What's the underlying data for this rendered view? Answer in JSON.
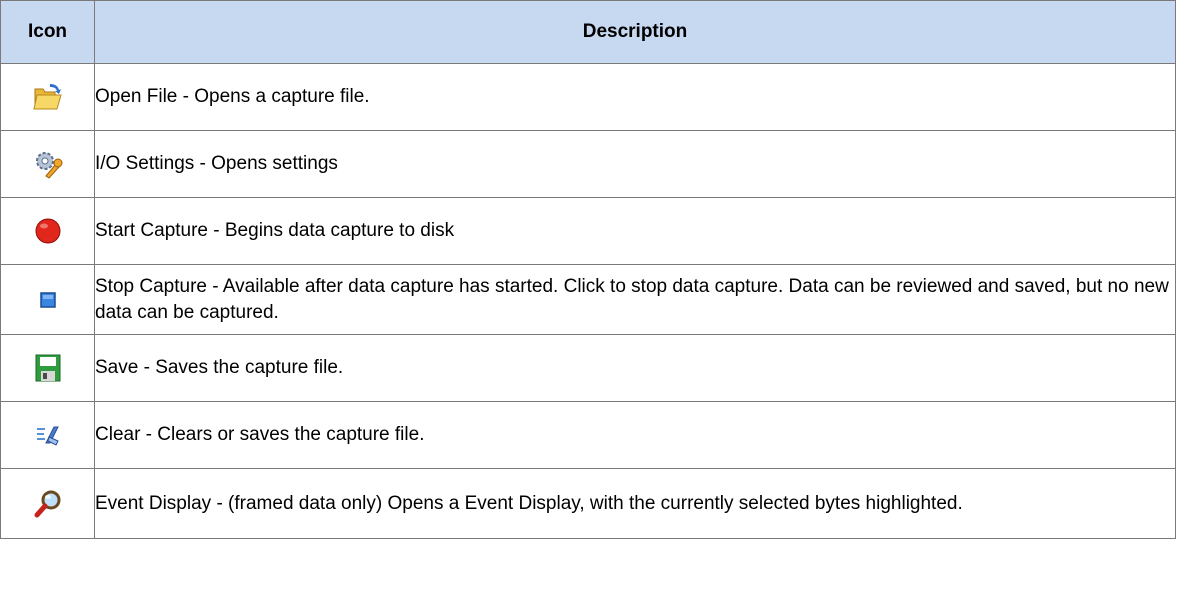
{
  "table": {
    "headers": {
      "icon": "Icon",
      "description": "Description"
    },
    "rows": [
      {
        "icon": "open-folder-icon",
        "description": "Open File - Opens a capture file."
      },
      {
        "icon": "io-settings-gear-wrench-icon",
        "description": "I/O Settings - Opens settings"
      },
      {
        "icon": "record-red-circle-icon",
        "description": "Start Capture - Begins data capture to disk"
      },
      {
        "icon": "stop-blue-square-icon",
        "description": "Stop Capture - Available after data capture has started. Click to stop data capture.  Data can be reviewed and saved, but no new data can be captured."
      },
      {
        "icon": "save-floppy-icon",
        "description": "Save - Saves the capture file."
      },
      {
        "icon": "clear-icon",
        "description": "Clear  - Clears or saves the capture file."
      },
      {
        "icon": "magnifier-icon",
        "description": "Event Display - (framed data only) Opens a Event Display, with the currently selected bytes highlighted."
      }
    ]
  }
}
